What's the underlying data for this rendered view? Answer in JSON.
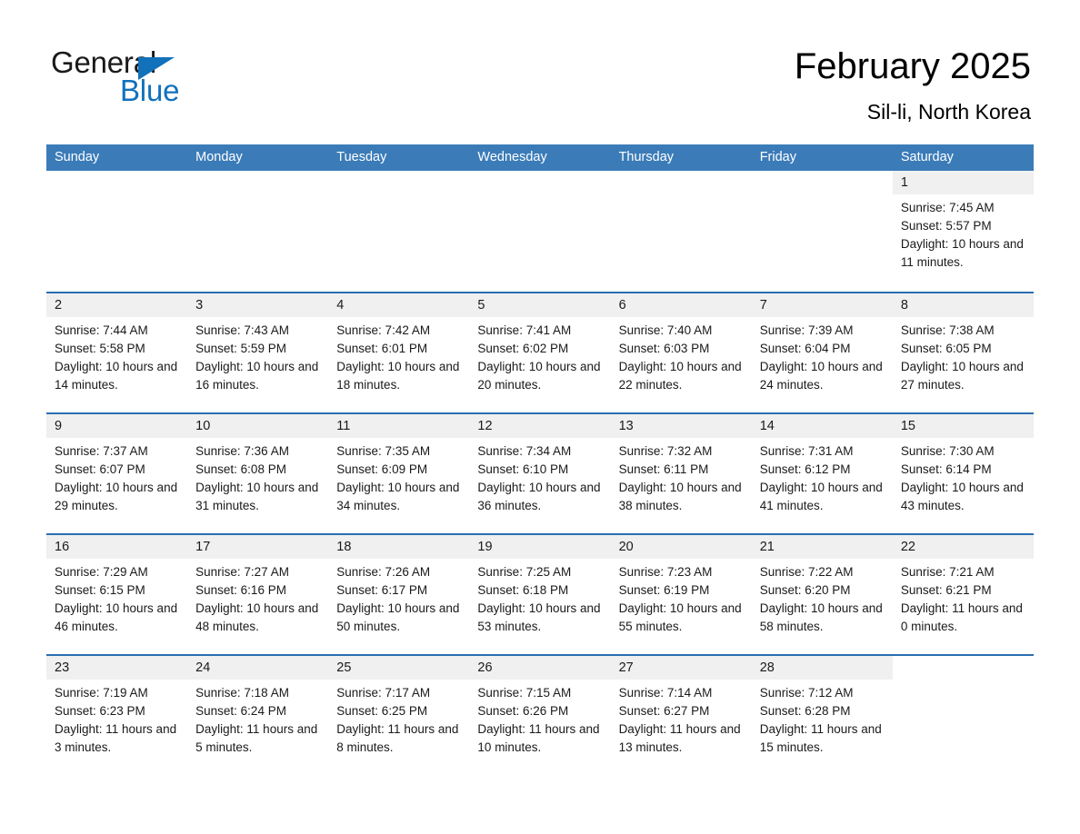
{
  "brand": {
    "name_part1": "General",
    "name_part2": "Blue",
    "accent_color": "#1271bb",
    "triangle_icon": "triangle-icon"
  },
  "header": {
    "title": "February 2025",
    "subtitle": "Sil-li, North Korea"
  },
  "calendar": {
    "header_bg": "#3b7cb8",
    "week_divider_color": "#2a6eb0",
    "day_number_bg": "#f0f0f0",
    "weekdays": [
      "Sunday",
      "Monday",
      "Tuesday",
      "Wednesday",
      "Thursday",
      "Friday",
      "Saturday"
    ],
    "weeks": [
      [
        {
          "day": "",
          "blank": true
        },
        {
          "day": "",
          "blank": true
        },
        {
          "day": "",
          "blank": true
        },
        {
          "day": "",
          "blank": true
        },
        {
          "day": "",
          "blank": true
        },
        {
          "day": "",
          "blank": true
        },
        {
          "day": "1",
          "sunrise": "Sunrise: 7:45 AM",
          "sunset": "Sunset: 5:57 PM",
          "daylight": "Daylight: 10 hours and 11 minutes."
        }
      ],
      [
        {
          "day": "2",
          "sunrise": "Sunrise: 7:44 AM",
          "sunset": "Sunset: 5:58 PM",
          "daylight": "Daylight: 10 hours and 14 minutes."
        },
        {
          "day": "3",
          "sunrise": "Sunrise: 7:43 AM",
          "sunset": "Sunset: 5:59 PM",
          "daylight": "Daylight: 10 hours and 16 minutes."
        },
        {
          "day": "4",
          "sunrise": "Sunrise: 7:42 AM",
          "sunset": "Sunset: 6:01 PM",
          "daylight": "Daylight: 10 hours and 18 minutes."
        },
        {
          "day": "5",
          "sunrise": "Sunrise: 7:41 AM",
          "sunset": "Sunset: 6:02 PM",
          "daylight": "Daylight: 10 hours and 20 minutes."
        },
        {
          "day": "6",
          "sunrise": "Sunrise: 7:40 AM",
          "sunset": "Sunset: 6:03 PM",
          "daylight": "Daylight: 10 hours and 22 minutes."
        },
        {
          "day": "7",
          "sunrise": "Sunrise: 7:39 AM",
          "sunset": "Sunset: 6:04 PM",
          "daylight": "Daylight: 10 hours and 24 minutes."
        },
        {
          "day": "8",
          "sunrise": "Sunrise: 7:38 AM",
          "sunset": "Sunset: 6:05 PM",
          "daylight": "Daylight: 10 hours and 27 minutes."
        }
      ],
      [
        {
          "day": "9",
          "sunrise": "Sunrise: 7:37 AM",
          "sunset": "Sunset: 6:07 PM",
          "daylight": "Daylight: 10 hours and 29 minutes."
        },
        {
          "day": "10",
          "sunrise": "Sunrise: 7:36 AM",
          "sunset": "Sunset: 6:08 PM",
          "daylight": "Daylight: 10 hours and 31 minutes."
        },
        {
          "day": "11",
          "sunrise": "Sunrise: 7:35 AM",
          "sunset": "Sunset: 6:09 PM",
          "daylight": "Daylight: 10 hours and 34 minutes."
        },
        {
          "day": "12",
          "sunrise": "Sunrise: 7:34 AM",
          "sunset": "Sunset: 6:10 PM",
          "daylight": "Daylight: 10 hours and 36 minutes."
        },
        {
          "day": "13",
          "sunrise": "Sunrise: 7:32 AM",
          "sunset": "Sunset: 6:11 PM",
          "daylight": "Daylight: 10 hours and 38 minutes."
        },
        {
          "day": "14",
          "sunrise": "Sunrise: 7:31 AM",
          "sunset": "Sunset: 6:12 PM",
          "daylight": "Daylight: 10 hours and 41 minutes."
        },
        {
          "day": "15",
          "sunrise": "Sunrise: 7:30 AM",
          "sunset": "Sunset: 6:14 PM",
          "daylight": "Daylight: 10 hours and 43 minutes."
        }
      ],
      [
        {
          "day": "16",
          "sunrise": "Sunrise: 7:29 AM",
          "sunset": "Sunset: 6:15 PM",
          "daylight": "Daylight: 10 hours and 46 minutes."
        },
        {
          "day": "17",
          "sunrise": "Sunrise: 7:27 AM",
          "sunset": "Sunset: 6:16 PM",
          "daylight": "Daylight: 10 hours and 48 minutes."
        },
        {
          "day": "18",
          "sunrise": "Sunrise: 7:26 AM",
          "sunset": "Sunset: 6:17 PM",
          "daylight": "Daylight: 10 hours and 50 minutes."
        },
        {
          "day": "19",
          "sunrise": "Sunrise: 7:25 AM",
          "sunset": "Sunset: 6:18 PM",
          "daylight": "Daylight: 10 hours and 53 minutes."
        },
        {
          "day": "20",
          "sunrise": "Sunrise: 7:23 AM",
          "sunset": "Sunset: 6:19 PM",
          "daylight": "Daylight: 10 hours and 55 minutes."
        },
        {
          "day": "21",
          "sunrise": "Sunrise: 7:22 AM",
          "sunset": "Sunset: 6:20 PM",
          "daylight": "Daylight: 10 hours and 58 minutes."
        },
        {
          "day": "22",
          "sunrise": "Sunrise: 7:21 AM",
          "sunset": "Sunset: 6:21 PM",
          "daylight": "Daylight: 11 hours and 0 minutes."
        }
      ],
      [
        {
          "day": "23",
          "sunrise": "Sunrise: 7:19 AM",
          "sunset": "Sunset: 6:23 PM",
          "daylight": "Daylight: 11 hours and 3 minutes."
        },
        {
          "day": "24",
          "sunrise": "Sunrise: 7:18 AM",
          "sunset": "Sunset: 6:24 PM",
          "daylight": "Daylight: 11 hours and 5 minutes."
        },
        {
          "day": "25",
          "sunrise": "Sunrise: 7:17 AM",
          "sunset": "Sunset: 6:25 PM",
          "daylight": "Daylight: 11 hours and 8 minutes."
        },
        {
          "day": "26",
          "sunrise": "Sunrise: 7:15 AM",
          "sunset": "Sunset: 6:26 PM",
          "daylight": "Daylight: 11 hours and 10 minutes."
        },
        {
          "day": "27",
          "sunrise": "Sunrise: 7:14 AM",
          "sunset": "Sunset: 6:27 PM",
          "daylight": "Daylight: 11 hours and 13 minutes."
        },
        {
          "day": "28",
          "sunrise": "Sunrise: 7:12 AM",
          "sunset": "Sunset: 6:28 PM",
          "daylight": "Daylight: 11 hours and 15 minutes."
        },
        {
          "day": "",
          "blank": true
        }
      ]
    ]
  }
}
